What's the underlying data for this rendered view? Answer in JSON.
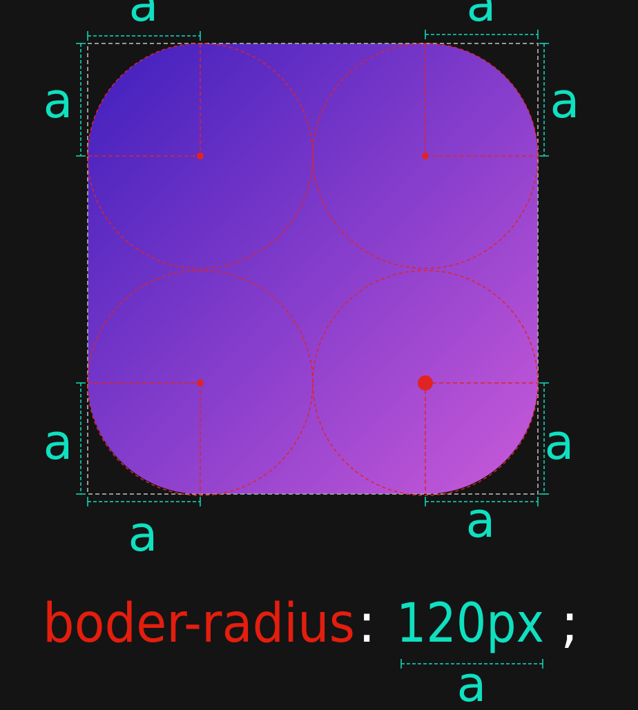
{
  "diagram": {
    "radius_label": "a",
    "labels": {
      "top_left_h": "a",
      "top_right_h": "a",
      "top_left_v": "a",
      "top_right_v": "a",
      "bottom_left_v": "a",
      "bottom_right_v": "a",
      "bottom_left_h": "a",
      "bottom_right_h": "a",
      "value_label": "a"
    },
    "code": {
      "property": "boder-radius",
      "colon": ":",
      "value": "120px",
      "semicolon": ";"
    },
    "colors": {
      "background": "#141414",
      "gradient_start": "#3f1fbd",
      "gradient_end": "#c95ad9",
      "guide_red": "#e02424",
      "dimension_teal": "#0fe0c0",
      "bounding_box": "#9a9a9a",
      "property_red": "#e41e0e",
      "punctuation": "#ffffff"
    }
  }
}
